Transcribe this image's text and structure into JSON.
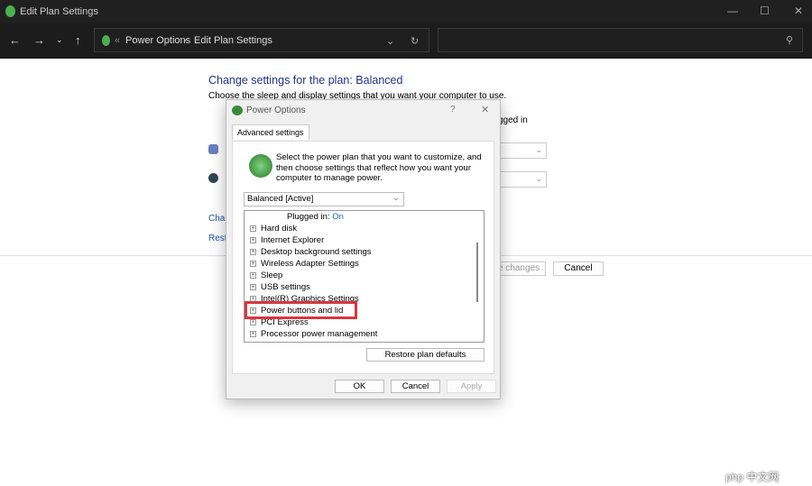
{
  "window": {
    "title": "Edit Plan Settings"
  },
  "address": {
    "breadcrumb": [
      "Power Options",
      "Edit Plan Settings"
    ],
    "search_placeholder": ""
  },
  "page": {
    "heading": "Change settings for the plan: Balanced",
    "subheading": "Choose the sleep and display settings that you want your computer to use.",
    "column_partial": "gged in",
    "link1_partial": "Char",
    "link2_partial": "Resto",
    "save_partial": "e changes",
    "cancel": "Cancel"
  },
  "dialog": {
    "title": "Power Options",
    "help": "?",
    "close": "✕",
    "tab": "Advanced settings",
    "description": "Select the power plan that you want to customize, and then choose settings that reflect how you want your computer to manage power.",
    "plan": "Balanced [Active]",
    "plugged_label": "Plugged in:",
    "plugged_value": "On",
    "items": [
      "Hard disk",
      "Internet Explorer",
      "Desktop background settings",
      "Wireless Adapter Settings",
      "Sleep",
      "USB settings",
      "Intel(R) Graphics Settings",
      "Power buttons and lid",
      "PCI Express",
      "Processor power management"
    ],
    "highlighted_item": "Power buttons and lid",
    "restore": "Restore plan defaults",
    "ok": "OK",
    "cancel": "Cancel",
    "apply": "Apply"
  },
  "watermark": "php 中文网",
  "colors": {
    "highlight": "#d9363e",
    "heading": "#1e3287",
    "link": "#1a56b0"
  }
}
